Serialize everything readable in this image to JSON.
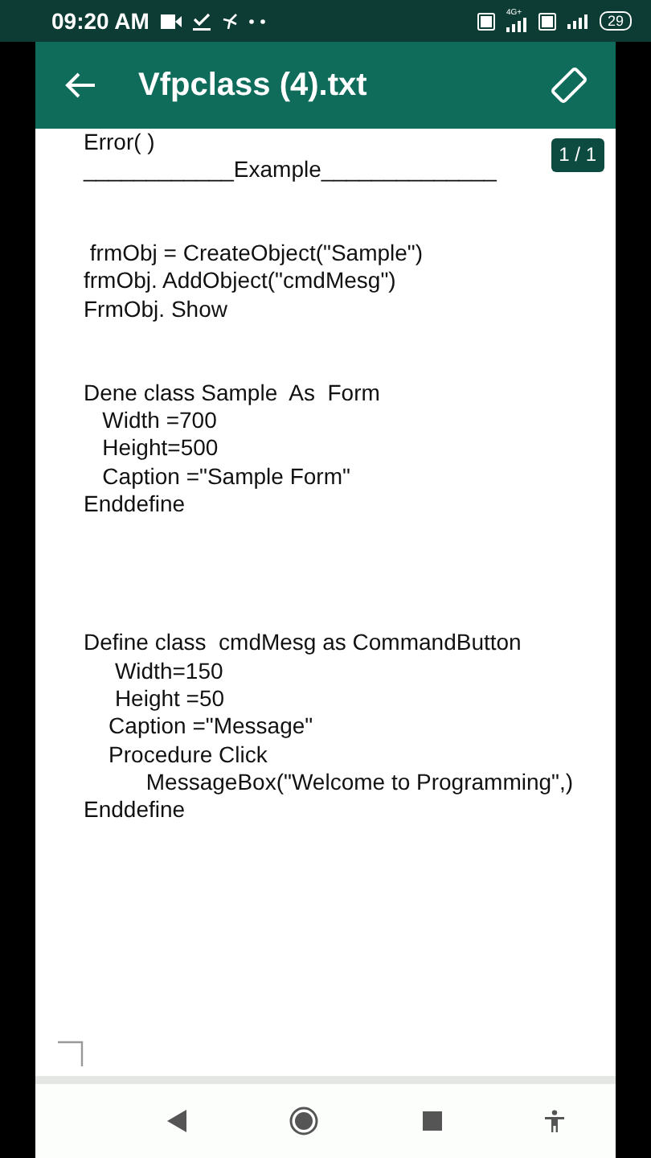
{
  "status_bar": {
    "time": "09:20 AM",
    "network_type": "4G+",
    "battery": "29"
  },
  "app_bar": {
    "title": "Vfpclass (4).txt"
  },
  "document": {
    "page_indicator": "1 / 1",
    "blocks": [
      {
        "lines": [
          "Error( )",
          "____________Example______________"
        ]
      },
      {
        "lines": [
          " frmObj = CreateObject(\"Sample\")",
          "frmObj. AddObject(\"cmdMesg\")",
          "FrmObj. Show"
        ]
      },
      {
        "lines": [
          "Dene class Sample  As  Form",
          "   Width =700",
          "   Height=500",
          "   Caption =\"Sample Form\"",
          "Enddefine"
        ]
      },
      {
        "lines": [
          "Define class  cmdMesg as CommandButton",
          "     Width=150",
          "     Height =50",
          "    Caption =\"Message\"",
          "    Procedure Click",
          "          MessageBox(\"Welcome to Programming\",)",
          "Enddefine"
        ]
      }
    ]
  }
}
